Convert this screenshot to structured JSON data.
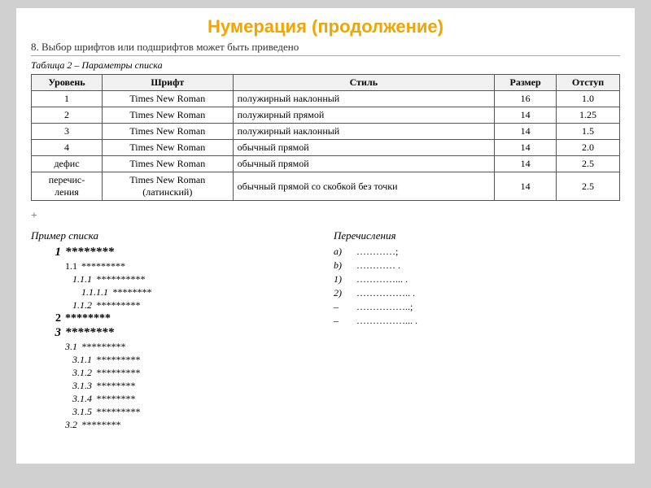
{
  "title": "Нумерация (продолжение)",
  "subtitle": "8. Выбор шрифтов или подшрифтов может быть приведено",
  "table_caption": "Таблица 2 – Параметры списка",
  "table": {
    "headers": [
      "Уровень",
      "Шрифт",
      "Стиль",
      "Размер",
      "Отступ"
    ],
    "rows": [
      {
        "level": "1",
        "font": "Times New Roman",
        "style": "полужирный наклонный",
        "size": "16",
        "indent": "1.0"
      },
      {
        "level": "2",
        "font": "Times New Roman",
        "style": "полужирный прямой",
        "size": "14",
        "indent": "1.25"
      },
      {
        "level": "3",
        "font": "Times New Roman",
        "style": "полужирный наклонный",
        "size": "14",
        "indent": "1.5"
      },
      {
        "level": "4",
        "font": "Times New Roman",
        "style": "обычный прямой",
        "size": "14",
        "indent": "2.0"
      },
      {
        "level": "дефис",
        "font": "Times New Roman",
        "style": "обычный прямой",
        "size": "14",
        "indent": "2.5"
      },
      {
        "level": "перечис-\nления",
        "font": "Times New Roman\n(латинский)",
        "style": "обычный прямой со скобкой без точки",
        "size": "14",
        "indent": "2.5"
      }
    ]
  },
  "left_section_title": "Пример списка",
  "left_items": [
    {
      "label": "1",
      "text": "********",
      "level": "1"
    },
    {
      "label": "1.1",
      "text": "*********",
      "level": "2"
    },
    {
      "label": "1.1.1",
      "text": "**********",
      "level": "3"
    },
    {
      "label": "1.1.1.1",
      "text": "********",
      "level": "4"
    },
    {
      "label": "1.1.2",
      "text": "*********",
      "level": "3b"
    },
    {
      "label": "2",
      "text": "********",
      "level": "1b"
    },
    {
      "label": "3",
      "text": "********",
      "level": "1c"
    },
    {
      "label": "3.1",
      "text": "*********",
      "level": "2c"
    },
    {
      "label": "3.1.1",
      "text": "*********",
      "level": "3c"
    },
    {
      "label": "3.1.2",
      "text": "*********",
      "level": "3c"
    },
    {
      "label": "3.1.3",
      "text": "********",
      "level": "3c"
    },
    {
      "label": "3.1.4",
      "text": "********",
      "level": "3c"
    },
    {
      "label": "3.1.5",
      "text": "*********",
      "level": "3c"
    },
    {
      "label": "3.2",
      "text": "********",
      "level": "2c"
    }
  ],
  "right_section_title": "Перечисления",
  "right_items": [
    {
      "label": "a)",
      "text": "…………;"
    },
    {
      "label": "b)",
      "text": "………… ."
    },
    {
      "label": "1)",
      "text": "…………... ."
    },
    {
      "label": "2)",
      "text": "…………….. ."
    },
    {
      "label": "–",
      "text": "……………..;"
    },
    {
      "label": "–",
      "text": "……………...  ."
    }
  ],
  "plus_icon": "+"
}
